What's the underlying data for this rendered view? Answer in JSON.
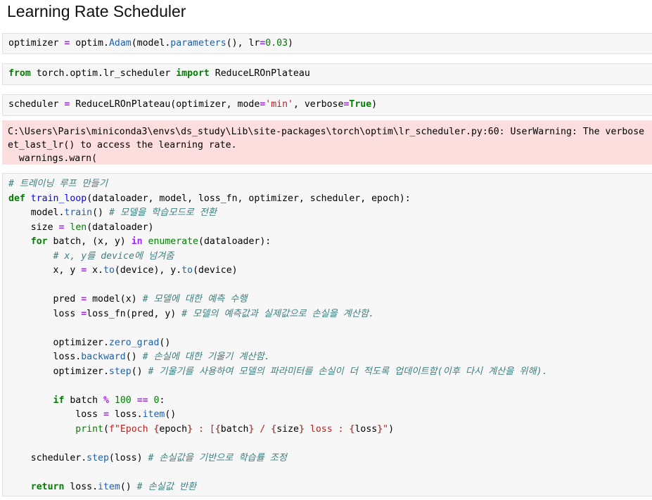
{
  "heading": "Learning Rate Scheduler",
  "cells": [
    {
      "id": "cell-1",
      "lines": [
        [
          [
            "optimizer ",
            "plain"
          ],
          [
            "=",
            "op"
          ],
          [
            " optim.",
            "plain"
          ],
          [
            "Adam",
            "attr"
          ],
          [
            "(model.",
            "plain"
          ],
          [
            "parameters",
            "attr"
          ],
          [
            "(), lr",
            "plain"
          ],
          [
            "=",
            "op"
          ],
          [
            "0.03",
            "num"
          ],
          [
            ")",
            "plain"
          ]
        ]
      ]
    },
    {
      "id": "cell-2",
      "lines": [
        [
          [
            "from",
            "kw"
          ],
          [
            " torch.optim.lr_scheduler ",
            "plain"
          ],
          [
            "import",
            "kw"
          ],
          [
            " ReduceLROnPlateau",
            "plain"
          ]
        ]
      ]
    },
    {
      "id": "cell-3",
      "lines": [
        [
          [
            "scheduler ",
            "plain"
          ],
          [
            "=",
            "op"
          ],
          [
            " ReduceLROnPlateau(optimizer, mode",
            "plain"
          ],
          [
            "=",
            "op"
          ],
          [
            "'min'",
            "str"
          ],
          [
            ", verbose",
            "plain"
          ],
          [
            "=",
            "op"
          ],
          [
            "True",
            "kw"
          ],
          [
            ")",
            "plain"
          ]
        ]
      ]
    },
    {
      "id": "cell-4",
      "lines": [
        [
          [
            "# 트레이닝 루프 만들기",
            "cm"
          ]
        ],
        [
          [
            "def",
            "kw"
          ],
          [
            " ",
            "plain"
          ],
          [
            "train_loop",
            "fn"
          ],
          [
            "(dataloader, model, loss_fn, optimizer, scheduler, epoch):",
            "plain"
          ]
        ],
        [
          [
            "    model.",
            "plain"
          ],
          [
            "train",
            "attr"
          ],
          [
            "() ",
            "plain"
          ],
          [
            "# 모델을 학습모드로 전환",
            "cm"
          ]
        ],
        [
          [
            "    size ",
            "plain"
          ],
          [
            "=",
            "op"
          ],
          [
            " ",
            "plain"
          ],
          [
            "len",
            "bi"
          ],
          [
            "(dataloader)",
            "plain"
          ]
        ],
        [
          [
            "    ",
            "plain"
          ],
          [
            "for",
            "kw"
          ],
          [
            " batch, (x, y) ",
            "plain"
          ],
          [
            "in",
            "op"
          ],
          [
            " ",
            "plain"
          ],
          [
            "enumerate",
            "bi"
          ],
          [
            "(dataloader):",
            "plain"
          ]
        ],
        [
          [
            "        ",
            "plain"
          ],
          [
            "# x, y를 device에 넘겨줌",
            "cm"
          ]
        ],
        [
          [
            "        x, y ",
            "plain"
          ],
          [
            "=",
            "op"
          ],
          [
            " x.",
            "plain"
          ],
          [
            "to",
            "attr"
          ],
          [
            "(device), y.",
            "plain"
          ],
          [
            "to",
            "attr"
          ],
          [
            "(device)",
            "plain"
          ]
        ],
        [
          [
            "",
            "plain"
          ]
        ],
        [
          [
            "        pred ",
            "plain"
          ],
          [
            "=",
            "op"
          ],
          [
            " model(x) ",
            "plain"
          ],
          [
            "# 모델에 대한 예측 수행",
            "cm"
          ]
        ],
        [
          [
            "        loss ",
            "plain"
          ],
          [
            "=",
            "op"
          ],
          [
            "loss_fn(pred, y) ",
            "plain"
          ],
          [
            "# 모델의 예측값과 실제값으로 손실을 계산함.",
            "cm"
          ]
        ],
        [
          [
            "",
            "plain"
          ]
        ],
        [
          [
            "        optimizer.",
            "plain"
          ],
          [
            "zero_grad",
            "attr"
          ],
          [
            "()",
            "plain"
          ]
        ],
        [
          [
            "        loss.",
            "plain"
          ],
          [
            "backward",
            "attr"
          ],
          [
            "() ",
            "plain"
          ],
          [
            "# 손실에 대한 기울기 계산함.",
            "cm"
          ]
        ],
        [
          [
            "        optimizer.",
            "plain"
          ],
          [
            "step",
            "attr"
          ],
          [
            "() ",
            "plain"
          ],
          [
            "# 기울기를 사용하여 모델의 파라미터를 손실이 더 적도록 업데이트함(이후 다시 계산을 위해).",
            "cm"
          ]
        ],
        [
          [
            "",
            "plain"
          ]
        ],
        [
          [
            "        ",
            "plain"
          ],
          [
            "if",
            "kw"
          ],
          [
            " batch ",
            "plain"
          ],
          [
            "%",
            "op"
          ],
          [
            " ",
            "plain"
          ],
          [
            "100",
            "num"
          ],
          [
            " ",
            "plain"
          ],
          [
            "==",
            "op"
          ],
          [
            " ",
            "plain"
          ],
          [
            "0",
            "num"
          ],
          [
            ":",
            "plain"
          ]
        ],
        [
          [
            "            loss ",
            "plain"
          ],
          [
            "=",
            "op"
          ],
          [
            " loss.",
            "plain"
          ],
          [
            "item",
            "attr"
          ],
          [
            "()",
            "plain"
          ]
        ],
        [
          [
            "            ",
            "plain"
          ],
          [
            "print",
            "bi"
          ],
          [
            "(",
            "plain"
          ],
          [
            "f\"Epoch ",
            "str"
          ],
          [
            "{",
            "sub"
          ],
          [
            "epoch",
            "plain"
          ],
          [
            "}",
            "sub"
          ],
          [
            " : [",
            "str"
          ],
          [
            "{",
            "sub"
          ],
          [
            "batch",
            "plain"
          ],
          [
            "}",
            "sub"
          ],
          [
            " / ",
            "str"
          ],
          [
            "{",
            "sub"
          ],
          [
            "size",
            "plain"
          ],
          [
            "}",
            "sub"
          ],
          [
            " loss : ",
            "str"
          ],
          [
            "{",
            "sub"
          ],
          [
            "loss",
            "plain"
          ],
          [
            "}",
            "sub"
          ],
          [
            "\"",
            "str"
          ],
          [
            ")",
            "plain"
          ]
        ],
        [
          [
            "",
            "plain"
          ]
        ],
        [
          [
            "    scheduler.",
            "plain"
          ],
          [
            "step",
            "attr"
          ],
          [
            "(loss) ",
            "plain"
          ],
          [
            "# 손실값을 기반으로 학습률 조정",
            "cm"
          ]
        ],
        [
          [
            "",
            "plain"
          ]
        ],
        [
          [
            "    ",
            "plain"
          ],
          [
            "return",
            "kw"
          ],
          [
            " loss.",
            "plain"
          ],
          [
            "item",
            "attr"
          ],
          [
            "() ",
            "plain"
          ],
          [
            "# 손실값 반환",
            "cm"
          ]
        ]
      ]
    }
  ],
  "warning_output": {
    "lines": [
      "C:\\Users\\Paris\\miniconda3\\envs\\ds_study\\Lib\\site-packages\\torch\\optim\\lr_scheduler.py:60: UserWarning: The verbose",
      "et_last_lr() to access the learning rate.",
      "  warnings.warn("
    ]
  }
}
